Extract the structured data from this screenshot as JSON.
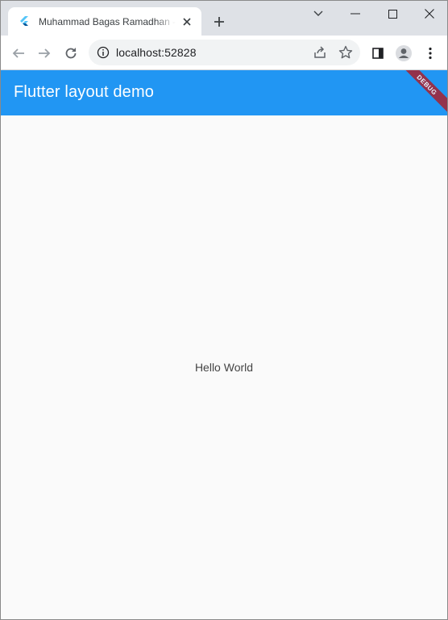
{
  "browser": {
    "tab": {
      "title": "Muhammad Bagas Ramadhan - Flutter layout demo"
    },
    "address": {
      "url": "localhost:52828"
    }
  },
  "app": {
    "appbar_title": "Flutter layout demo",
    "debug_banner": "DEBUG",
    "body_text": "Hello World"
  },
  "colors": {
    "appbar": "#2196f3",
    "debug_banner": "#a0283a",
    "tabstrip": "#dee1e6"
  }
}
